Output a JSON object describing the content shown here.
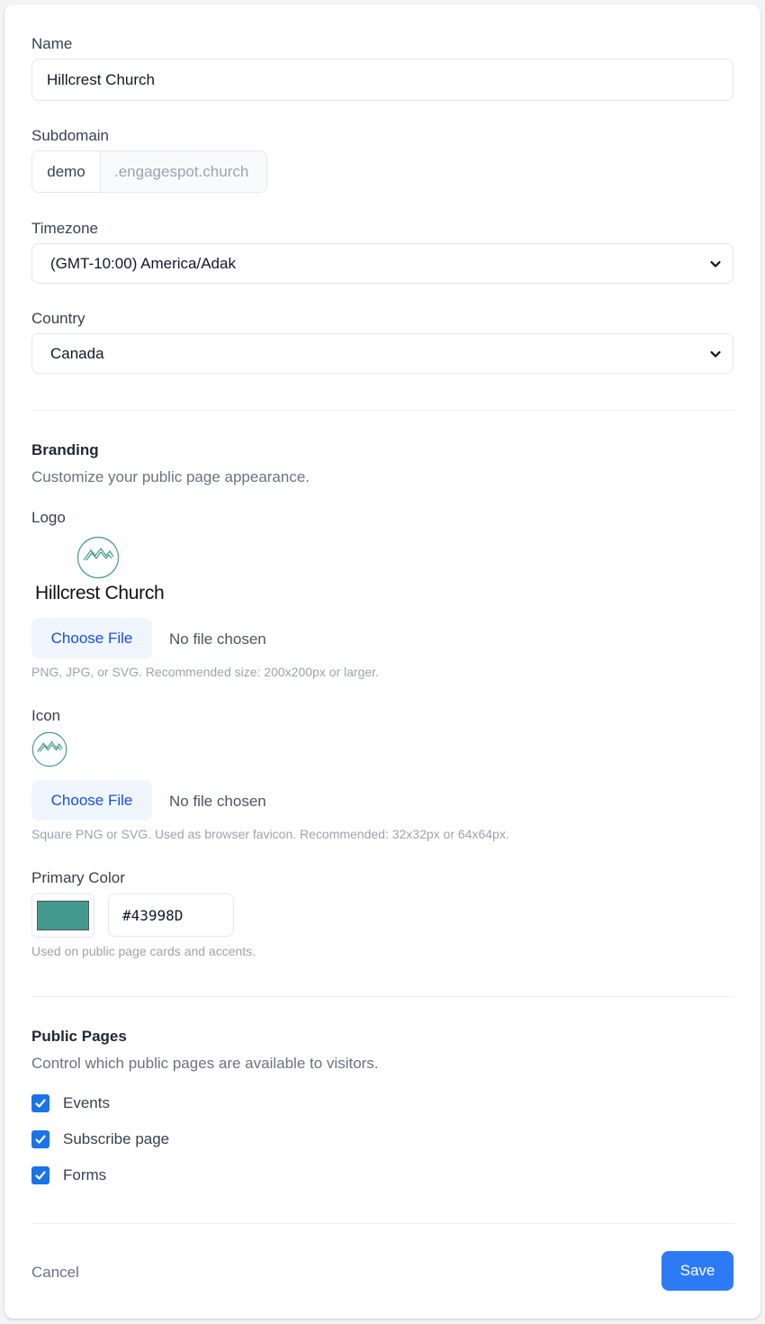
{
  "form": {
    "name_label": "Name",
    "name_value": "Hillcrest Church",
    "subdomain_label": "Subdomain",
    "subdomain_value": "demo",
    "subdomain_suffix": ".engagespot.church",
    "timezone_label": "Timezone",
    "timezone_value": "(GMT-10:00) America/Adak",
    "country_label": "Country",
    "country_value": "Canada"
  },
  "branding": {
    "title": "Branding",
    "description": "Customize your public page appearance.",
    "logo_label": "Logo",
    "logo_text": "Hillcrest Church",
    "logo_choose": "Choose File",
    "logo_status": "No file chosen",
    "logo_help": "PNG, JPG, or SVG. Recommended size: 200x200px or larger.",
    "icon_label": "Icon",
    "icon_choose": "Choose File",
    "icon_status": "No file chosen",
    "icon_help": "Square PNG or SVG. Used as browser favicon. Recommended: 32x32px or 64x64px.",
    "color_label": "Primary Color",
    "color_value": "#43998D",
    "color_help": "Used on public page cards and accents.",
    "brand_color": "#43998D"
  },
  "public_pages": {
    "title": "Public Pages",
    "description": "Control which public pages are available to visitors.",
    "items": [
      {
        "label": "Events",
        "checked": true
      },
      {
        "label": "Subscribe page",
        "checked": true
      },
      {
        "label": "Forms",
        "checked": true
      }
    ]
  },
  "actions": {
    "cancel": "Cancel",
    "save": "Save"
  }
}
